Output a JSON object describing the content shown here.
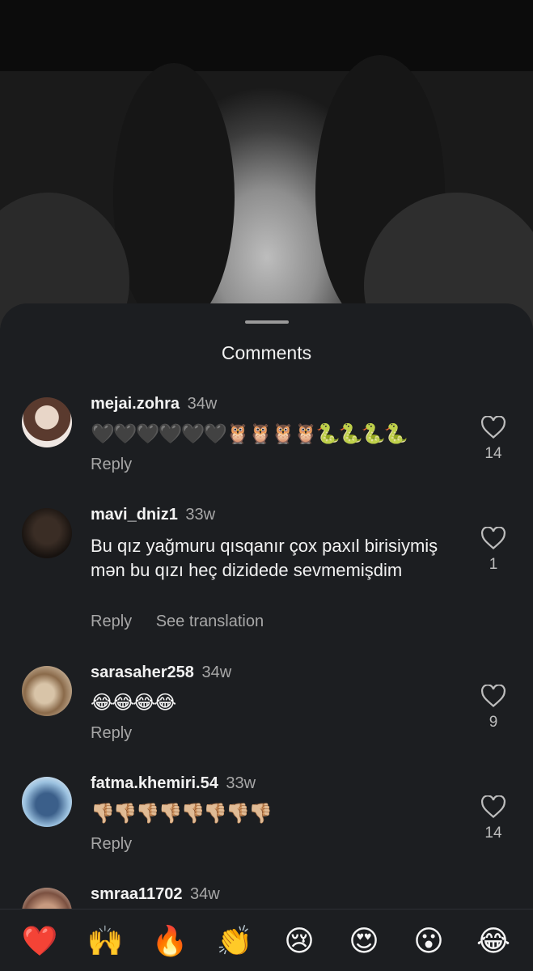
{
  "sheet": {
    "title": "Comments"
  },
  "comments": [
    {
      "username": "mejai.zohra",
      "time": "34w",
      "text": "🖤🖤🖤🖤🖤🖤🦉🦉🦉🦉🐍🐍🐍🐍",
      "likes": "14",
      "reply": "Reply"
    },
    {
      "username": "mavi_dniz1",
      "time": "33w",
      "text": "Bu qız yağmuru qısqanır çox paxıl birisiymiş mən bu qızı heç dizidede sevmemişdim",
      "likes": "1",
      "reply": "Reply",
      "translate": "See translation"
    },
    {
      "username": "sarasaher258",
      "time": "34w",
      "text": "😂😂😂😂",
      "likes": "9",
      "reply": "Reply"
    },
    {
      "username": "fatma.khemiri.54",
      "time": "33w",
      "text": "👎🏼👎🏼👎🏼👎🏼👎🏼👎🏼👎🏼👎🏼",
      "likes": "14",
      "reply": "Reply"
    },
    {
      "username": "smraa11702",
      "time": "34w"
    }
  ],
  "reactions": [
    "❤️",
    "🙌",
    "🔥",
    "👏",
    "😢",
    "😍",
    "😮",
    "😂"
  ]
}
